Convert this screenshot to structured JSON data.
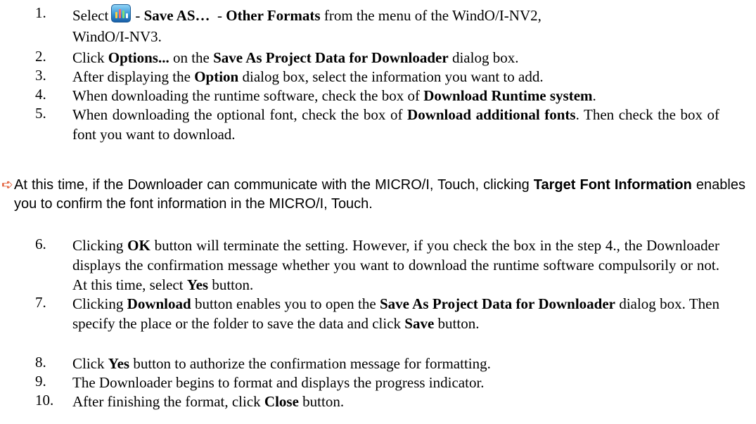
{
  "steps": [
    {
      "num": "1.",
      "pre": "Select",
      "icon": "app-menu-icon",
      "s1": "-",
      "b1": "Save AS…",
      "s2": "-",
      "b2": "Other Formats",
      "s3": "from the menu of the WindO/I-NV2,",
      "line2": "WindO/I-NV3."
    },
    {
      "num": "2.",
      "a": "Click ",
      "b1": "Options...",
      "c": " on the ",
      "b2": "Save As Project Data for Downloader",
      "d": " dialog box."
    },
    {
      "num": "3.",
      "a": "After displaying the ",
      "b1": "Option",
      "c": " dialog box, select the information you want to add."
    },
    {
      "num": "4.",
      "a": "When downloading the runtime software, check the box of ",
      "b1": "Download Runtime system",
      "c": "."
    },
    {
      "num": "5.",
      "a": "When downloading the optional font, check the box of ",
      "b1": "Download additional fonts",
      "c": ". Then check the box of font you want to download."
    },
    {
      "num": "6.",
      "a": "Clicking ",
      "b1": "OK",
      "c": " button will terminate the setting. However, if you check the box in the step 4., the Downloader displays the confirmation message whether you want to download the runtime software compulsorily or not. At this time, select ",
      "b2": "Yes",
      "d": " button."
    },
    {
      "num": "7.",
      "a": "Clicking ",
      "b1": "Download",
      "c": " button enables you to open the ",
      "b2": "Save As Project Data for Downloader",
      "d": " dialog box. Then specify the place or the folder to save the data and click ",
      "b3": "Save",
      "e": " button."
    },
    {
      "num": "8.",
      "a": "Click ",
      "b1": "Yes",
      "c": " button to authorize the confirmation message for formatting."
    },
    {
      "num": "9.",
      "a": "The Downloader begins to format and displays the progress indicator."
    },
    {
      "num": "10.",
      "a": "After finishing the format, click ",
      "b1": "Close",
      "c": " button."
    }
  ],
  "note": {
    "arrow": "➪",
    "a": "At this time, if the Downloader can communicate with the MICRO/I, Touch, clicking ",
    "b1": "Target Font Information",
    "c": " enables you to confirm the font information in the MICRO/I, Touch."
  },
  "colors": {
    "note_arrow": "#e0532b",
    "icon_blue": "#2f8fd0"
  }
}
